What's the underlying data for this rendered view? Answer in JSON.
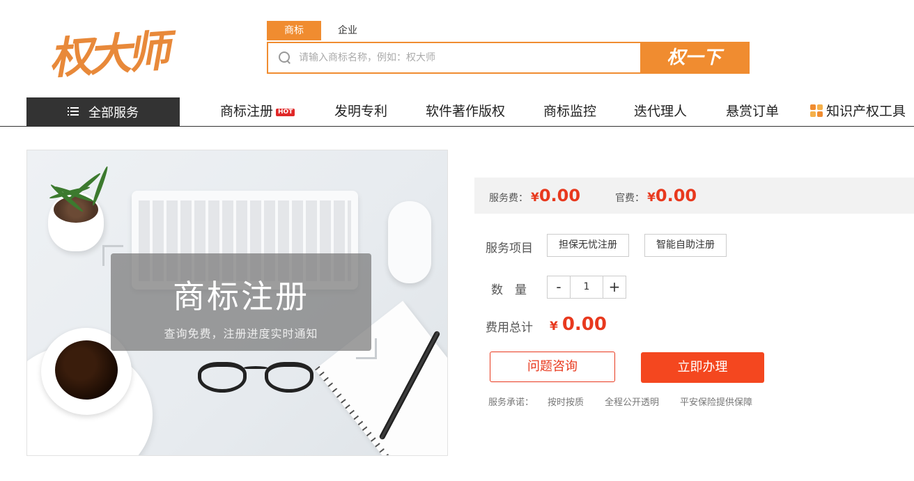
{
  "header": {
    "logo_text": "权大师",
    "search_tabs": [
      {
        "label": "商标",
        "active": true
      },
      {
        "label": "企业",
        "active": false
      }
    ],
    "search_placeholder": "请输入商标名称，例如：权大师",
    "search_button": "权一下"
  },
  "nav": {
    "all_services": "全部服务",
    "items": [
      {
        "label": "商标注册",
        "badge": "HOT"
      },
      {
        "label": "发明专利"
      },
      {
        "label": "软件著作版权"
      },
      {
        "label": "商标监控"
      },
      {
        "label": "迭代理人"
      },
      {
        "label": "悬赏订单"
      },
      {
        "label": "知识产权工具"
      }
    ]
  },
  "product_image": {
    "title": "商标注册",
    "subtitle": "查询免费，注册进度实时通知"
  },
  "price": {
    "service_fee_label": "服务费：",
    "service_fee_currency": "¥",
    "service_fee_value": "0.00",
    "official_fee_label": "官费：",
    "official_fee_currency": "¥",
    "official_fee_value": "0.00"
  },
  "service_items": {
    "label": "服务项目",
    "options": [
      "担保无忧注册",
      "智能自助注册"
    ]
  },
  "quantity": {
    "label": "数　量",
    "minus": "-",
    "value": "1",
    "plus": "+"
  },
  "total": {
    "label": "费用总计",
    "currency": "¥",
    "value": "0.00"
  },
  "actions": {
    "consult": "问题咨询",
    "buy": "立即办理"
  },
  "promise": {
    "label": "服务承诺：",
    "items": [
      "按时按质",
      "全程公开透明",
      "平安保险提供保障"
    ]
  },
  "colors": {
    "brand_orange": "#f08c30",
    "price_red": "#e8391e",
    "buy_button": "#f4471f",
    "nav_dark": "#333333"
  }
}
